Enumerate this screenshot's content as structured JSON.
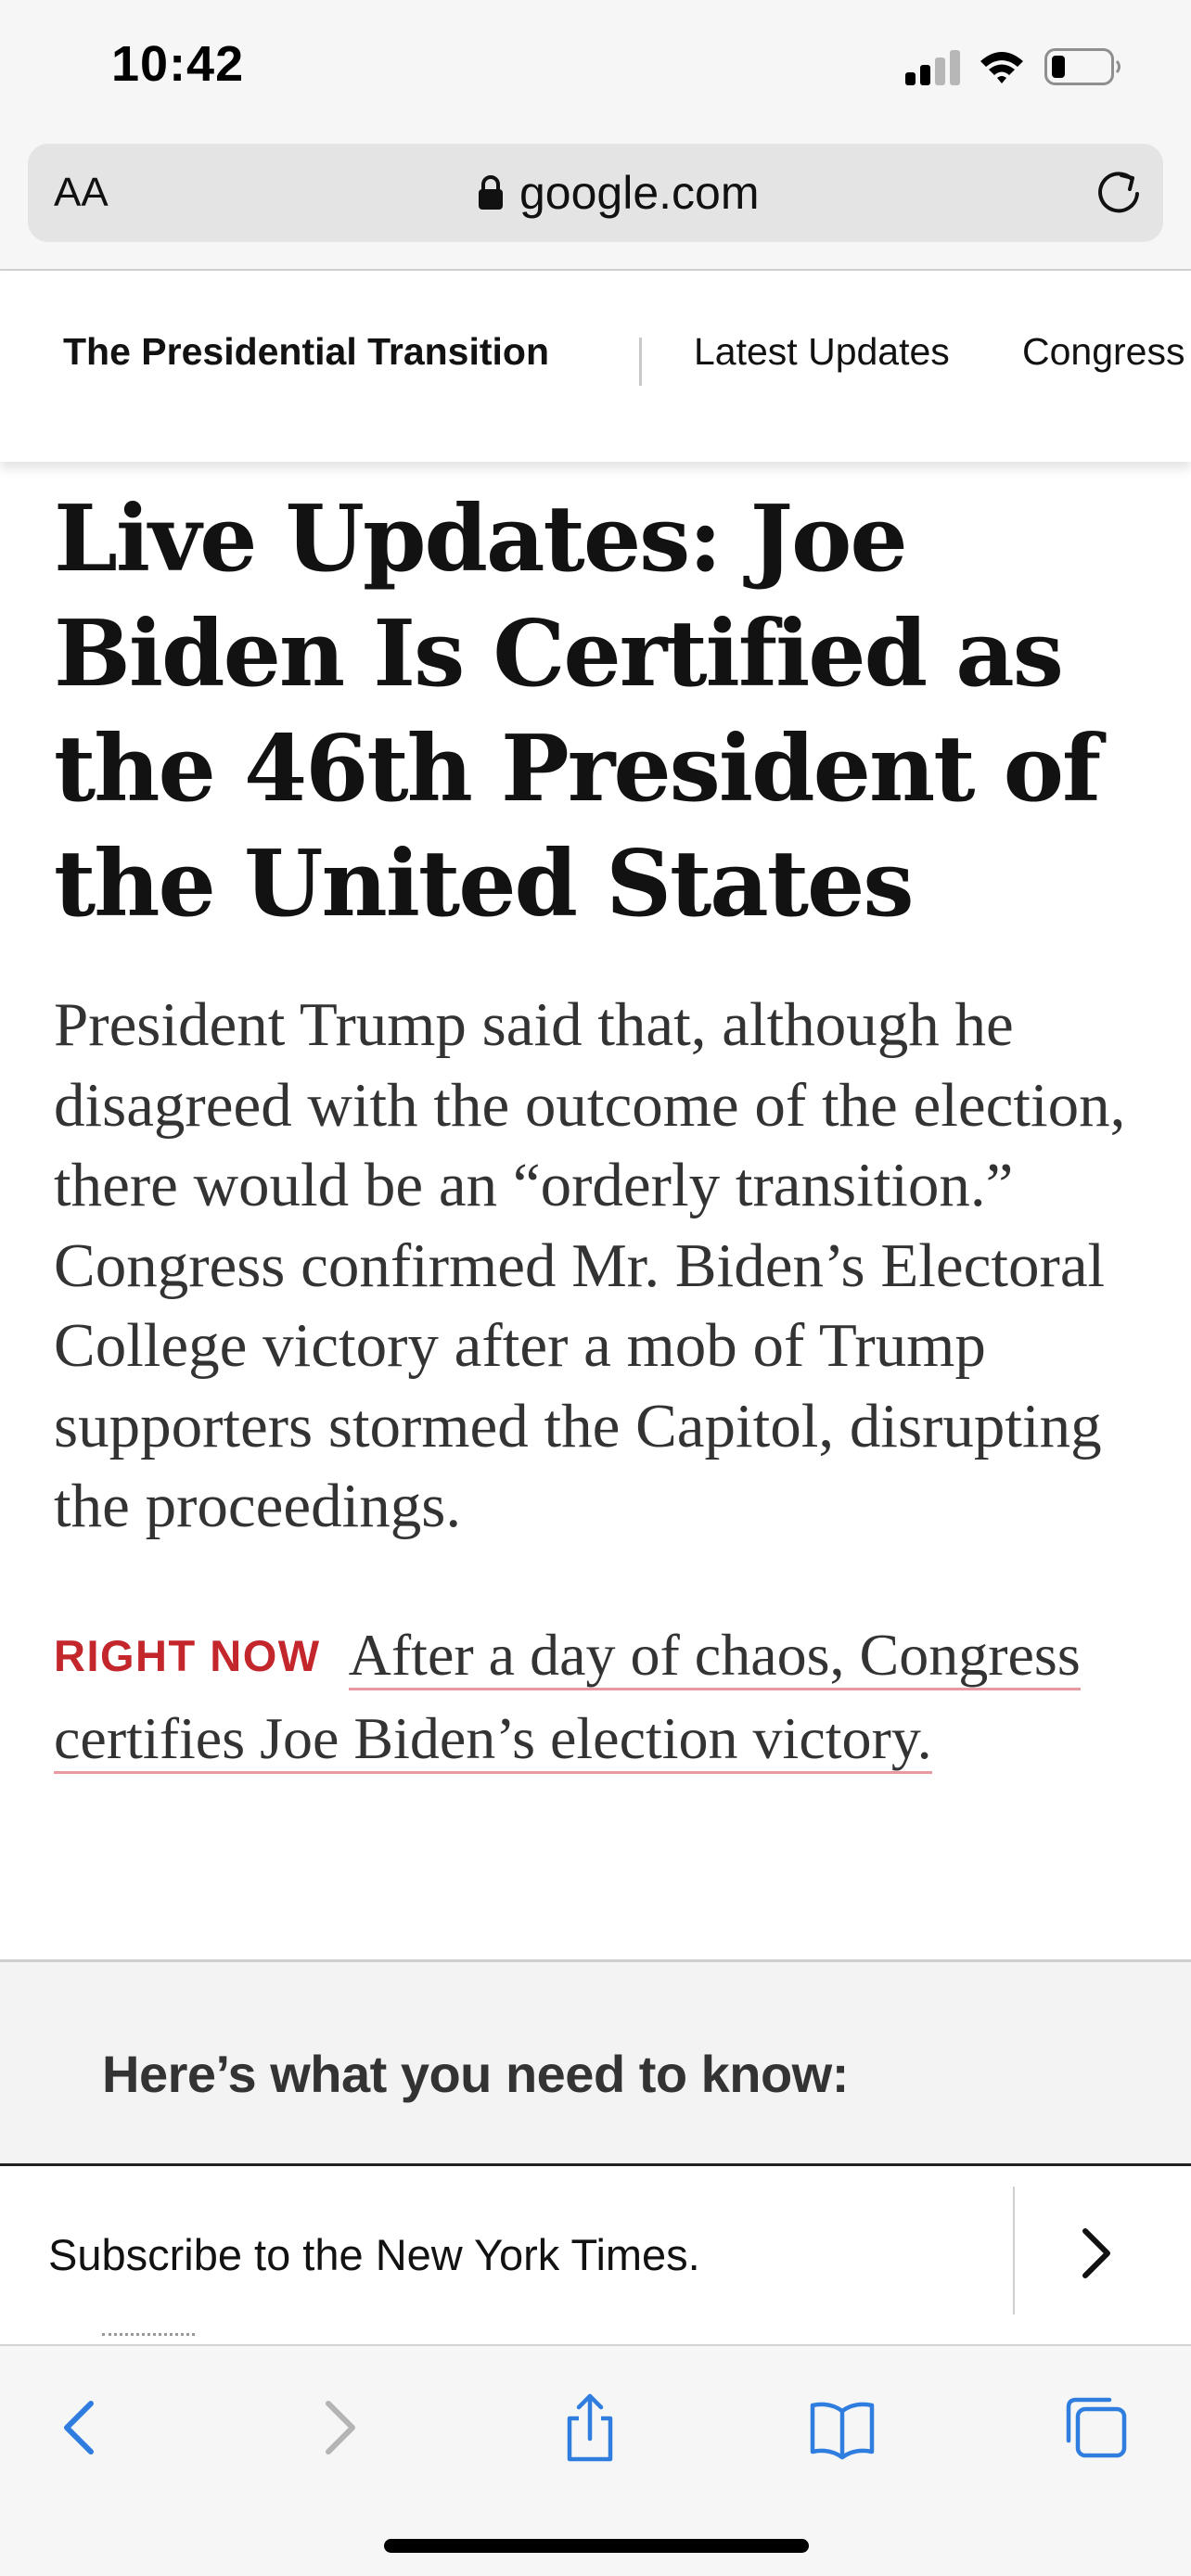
{
  "status_bar": {
    "time": "10:42"
  },
  "browser": {
    "aa_label": "AA",
    "url": "google.com",
    "accent_color": "#2f7dde"
  },
  "section_nav": {
    "title": "The Presidential Transition",
    "links": [
      "Latest Updates",
      "Congress"
    ]
  },
  "article": {
    "headline": "Live Updates: Joe Biden Is Certified as the 46th President of the United States",
    "summary": "President Trump said that, although he disagreed with the outcome of the election, there would be an “orderly transition.” Congress confirmed Mr. Biden’s Electoral College victory after a mob of Trump supporters stormed the Capitol, disrupting the proceedings.",
    "right_now_label": "RIGHT NOW",
    "right_now_link": "After a day of chaos, Congress certifies Joe Biden’s election victory.",
    "right_now_color": "#c3272c"
  },
  "need_to_know": {
    "heading": "Here’s what you need to know:"
  },
  "subscribe_banner": {
    "text": "Subscribe to the New York Times."
  },
  "toolbar": {
    "icons": [
      "back-icon",
      "forward-icon",
      "share-icon",
      "bookmarks-icon",
      "tabs-icon"
    ]
  }
}
